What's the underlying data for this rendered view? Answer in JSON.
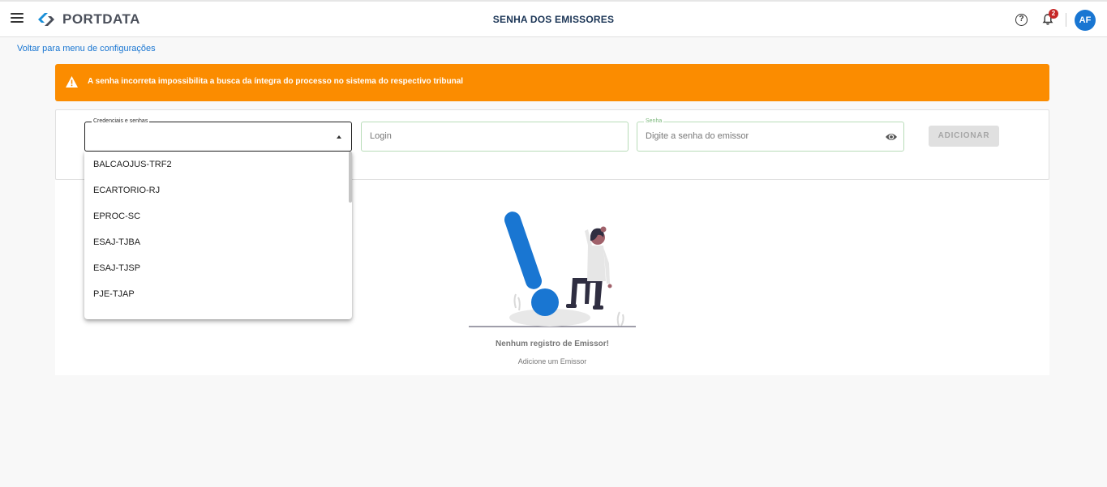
{
  "header": {
    "logo_text": "PORTDATA",
    "page_title": "SENHA DOS EMISSORES",
    "notification_count": "2",
    "avatar_initials": "AF",
    "help_glyph": "?"
  },
  "back_link": "Voltar para menu de configurações",
  "alert": {
    "text": "A senha incorreta impossibilita a busca da íntegra do processo no sistema do respectivo tribunal",
    "color": "#fb8c00"
  },
  "form": {
    "credentials_label": "Credenciais e senhas",
    "login_placeholder": "Login",
    "senha_label": "Senha",
    "senha_placeholder": "Digite a senha do emissor",
    "add_button": "ADICIONAR"
  },
  "dropdown": {
    "options": [
      "BALCAOJUS-TRF2",
      "ECARTORIO-RJ",
      "EPROC-SC",
      "ESAJ-TJBA",
      "ESAJ-TJSP",
      "PJE-TJAP"
    ]
  },
  "empty_state": {
    "title": "Nenhum registro de Emissor!",
    "subtitle": "Adicione um Emissor"
  },
  "colors": {
    "primary": "#1976d2",
    "title": "#1b3556",
    "badge": "#c62828"
  },
  "icons": [
    "menu-icon",
    "logo-icon",
    "help-icon",
    "bell-icon",
    "warning-icon",
    "caret-up-icon",
    "eye-icon"
  ]
}
